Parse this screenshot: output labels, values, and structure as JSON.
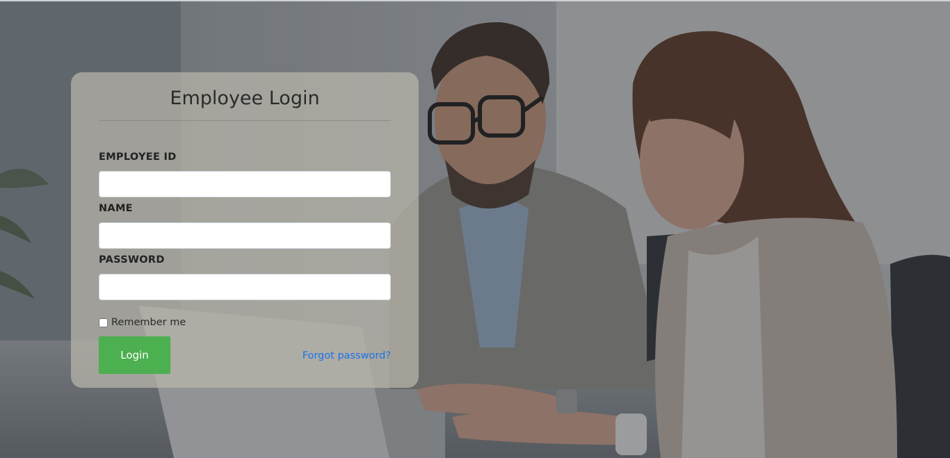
{
  "login_form": {
    "title": "Employee Login",
    "fields": [
      {
        "label": "EMPLOYEE ID",
        "value": "",
        "placeholder": ""
      },
      {
        "label": "NAME",
        "value": "",
        "placeholder": ""
      },
      {
        "label": "PASSWORD",
        "value": "",
        "placeholder": ""
      }
    ],
    "remember_label": "Remember me",
    "remember_checked": false,
    "login_label": "Login",
    "forgot_label": "Forgot password?"
  },
  "colors": {
    "login_button": "#4caf50",
    "forgot_link": "#1a73e8",
    "card_background": "#b9b6aa"
  }
}
